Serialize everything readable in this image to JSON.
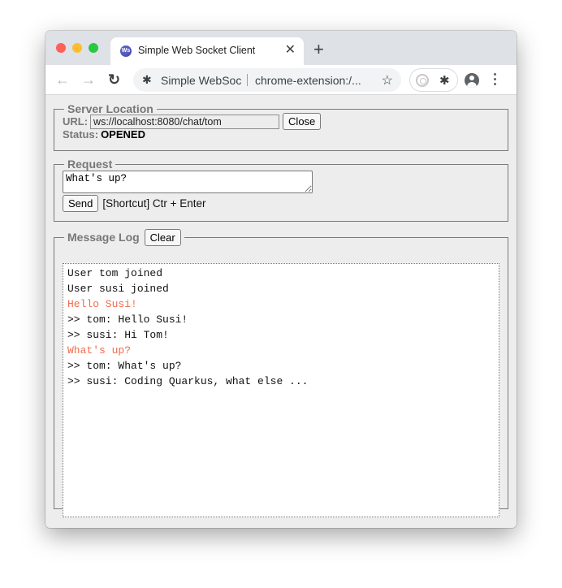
{
  "browser": {
    "tab": {
      "favicon_text": "Ws",
      "title": "Simple Web Socket Client",
      "close_glyph": "✕"
    },
    "new_tab_glyph": "+",
    "nav": {
      "back_glyph": "←",
      "forward_glyph": "→",
      "reload_glyph": "↻"
    },
    "omnibox": {
      "extension_glyph": "✱",
      "page_title": "Simple WebSocket Client",
      "url": "chrome-extension:/...",
      "star_glyph": "☆"
    },
    "extensions": {
      "puzzle_glyph": "✱"
    }
  },
  "server_location": {
    "legend": "Server Location",
    "url_label": "URL:",
    "url_value": "ws://localhost:8080/chat/tom",
    "close_button": "Close",
    "status_label": "Status:",
    "status_value": "OPENED"
  },
  "request": {
    "legend": "Request",
    "text_value": "What's up?",
    "send_button": "Send",
    "shortcut_hint": "[Shortcut] Ctr + Enter"
  },
  "message_log": {
    "legend": "Message Log",
    "clear_button": "Clear",
    "sent_color": "#f26b4e",
    "lines": [
      {
        "text": "User tom joined",
        "type": "received"
      },
      {
        "text": "User susi joined",
        "type": "received"
      },
      {
        "text": "Hello Susi!",
        "type": "sent"
      },
      {
        "text": ">> tom: Hello Susi!",
        "type": "received"
      },
      {
        "text": ">> susi: Hi Tom!",
        "type": "received"
      },
      {
        "text": "What's up?",
        "type": "sent"
      },
      {
        "text": ">> tom: What's up?",
        "type": "received"
      },
      {
        "text": ">> susi: Coding Quarkus, what else ...",
        "type": "received"
      }
    ]
  }
}
